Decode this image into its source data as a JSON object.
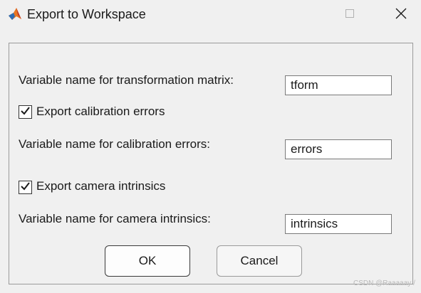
{
  "window": {
    "title": "Export to Workspace",
    "icon": "matlab-logo-icon"
  },
  "form": {
    "tform_label": "Variable name for transformation matrix:",
    "tform_value": "tform",
    "calib_checkbox_label": "Export calibration errors",
    "calib_checked": true,
    "errors_label": "Variable name for calibration errors:",
    "errors_value": "errors",
    "intrinsics_checkbox_label": "Export camera intrinsics",
    "intrinsics_checked": true,
    "intrinsics_label": "Variable name for camera intrinsics:",
    "intrinsics_value": "intrinsics"
  },
  "buttons": {
    "ok": "OK",
    "cancel": "Cancel"
  },
  "watermark": "CSDN @Raaaaay /"
}
